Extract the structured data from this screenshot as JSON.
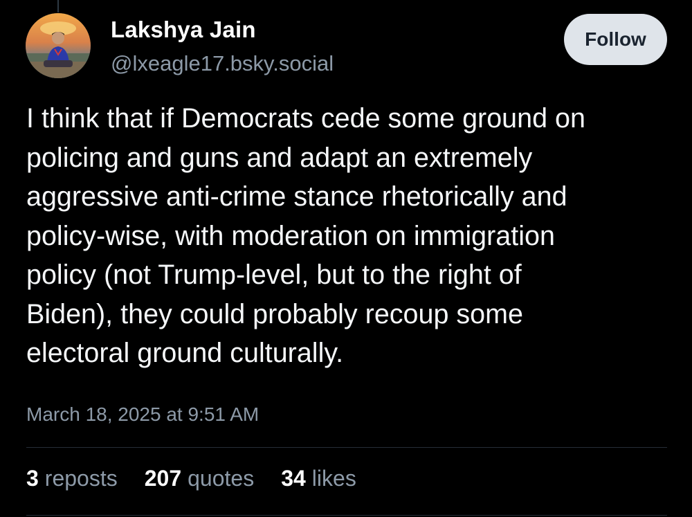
{
  "post": {
    "author": {
      "display_name": "Lakshya Jain",
      "handle": "@lxeagle17.bsky.social"
    },
    "follow_label": "Follow",
    "text_lines": [
      "I think that if Democrats cede some ground on",
      "policing and guns and adapt an extremely",
      "aggressive anti-crime stance rhetorically and",
      "policy-wise, with moderation on immigration",
      "policy (not Trump-level, but to the right of",
      "Biden), they could probably recoup some",
      "electoral ground culturally."
    ],
    "timestamp": "March 18, 2025 at 9:51 AM",
    "stats": {
      "reposts": {
        "count": "3",
        "label": "reposts"
      },
      "quotes": {
        "count": "207",
        "label": "quotes"
      },
      "likes": {
        "count": "34",
        "label": "likes"
      }
    }
  },
  "colors": {
    "background": "#000000",
    "text": "#ffffff",
    "muted_text": "#8d9aa8",
    "follow_button_bg": "#dfe4ea",
    "divider": "#262e38"
  },
  "icons": {
    "avatar": "user-avatar-photo"
  }
}
